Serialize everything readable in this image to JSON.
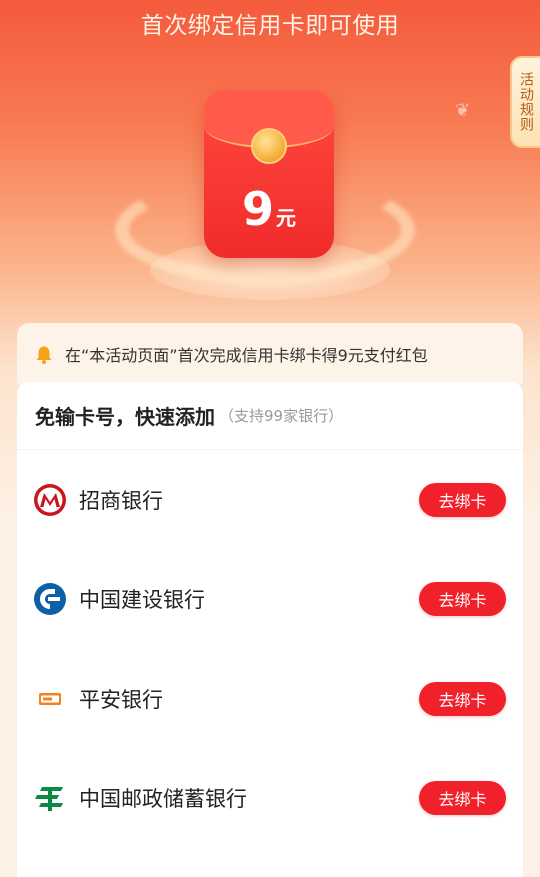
{
  "hero": {
    "title": "首次绑定信用卡即可使用",
    "rules_label": "活动规则",
    "envelope_amount": "9",
    "envelope_unit": "元"
  },
  "notice": {
    "text": "在“本活动页面”首次完成信用卡绑卡得9元支付红包"
  },
  "card": {
    "title": "免输卡号，快速添加",
    "subtitle": "（支持99家银行）",
    "banks": [
      {
        "name": "招商银行",
        "button": "去绑卡",
        "icon": "cmb-logo-icon"
      },
      {
        "name": "中国建设银行",
        "button": "去绑卡",
        "icon": "ccb-logo-icon"
      },
      {
        "name": "平安银行",
        "button": "去绑卡",
        "icon": "pingan-logo-icon"
      },
      {
        "name": "中国邮政储蓄银行",
        "button": "去绑卡",
        "icon": "psbc-logo-icon"
      }
    ]
  },
  "colors": {
    "accent": "#f0212a",
    "hero_top": "#f45a3c",
    "envelope": "#f02b2b",
    "page_bg": "#fdf1e6"
  }
}
